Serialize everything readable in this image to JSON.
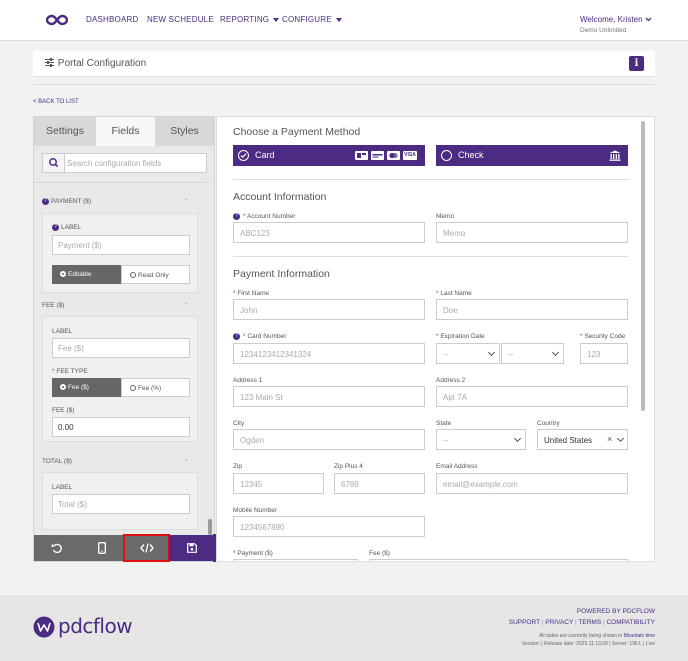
{
  "nav": {
    "items": [
      {
        "label": "DASHBOARD",
        "has_caret": false
      },
      {
        "label": "NEW SCHEDULE",
        "has_caret": false
      },
      {
        "label": "REPORTING",
        "has_caret": true
      },
      {
        "label": "CONFIGURE",
        "has_caret": true
      }
    ],
    "welcome": "Welcome, Kristen",
    "company": "Demo Unlimited",
    "accent_color": "#4b2c82",
    "logo_icon": "infinity-icon"
  },
  "header": {
    "title": "Portal Configuration",
    "title_icon": "sliders-icon",
    "info_label": "i"
  },
  "back_link": "< BACK TO LIST",
  "left_panel": {
    "tabs": [
      "Settings",
      "Fields",
      "Styles"
    ],
    "active_tab": "Fields",
    "search_placeholder": "Search configuration fields",
    "sections": {
      "payment": {
        "title": "PAYMENT ($)",
        "collapse": "-",
        "label_title": "LABEL",
        "label_placeholder": "Payment ($)",
        "mode_options": [
          "Editable",
          "Read Only"
        ],
        "mode_selected": "Editable"
      },
      "fee": {
        "title": "FEE ($)",
        "collapse": "-",
        "label_title": "LABEL",
        "label_placeholder": "Fee ($)",
        "fee_type_title": "FEE TYPE",
        "fee_type_options": [
          "Fee ($)",
          "Fee (%)"
        ],
        "fee_type_selected": "Fee ($)",
        "fee_amount_title": "FEE ($)",
        "fee_amount_value": "0.00"
      },
      "total": {
        "title": "TOTAL ($)",
        "collapse": "-",
        "label_title": "LABEL",
        "label_placeholder": "Total ($)"
      }
    },
    "toolbar": [
      "undo-icon",
      "mobile-icon",
      "code-icon",
      "save-icon"
    ],
    "collapse_icon": "double-chevron-left-icon"
  },
  "form": {
    "payment_method_title": "Choose a Payment Method",
    "methods": [
      {
        "label": "Card",
        "icons": [
          "discover-card-icon",
          "amex-card-icon",
          "mastercard-icon",
          "visa-icon"
        ],
        "visa_text": "VISA"
      },
      {
        "label": "Check",
        "icons": [
          "bank-icon"
        ]
      }
    ],
    "account_info_title": "Account Information",
    "account_number_label": "Account Number",
    "account_number_placeholder": "ABC123",
    "memo_label": "Memo",
    "memo_placeholder": "Memo",
    "payment_info_title": "Payment Information",
    "first_name_label": "First Name",
    "first_name_placeholder": "John",
    "last_name_label": "Last Name",
    "last_name_placeholder": "Doe",
    "card_number_label": "Card Number",
    "card_number_placeholder": "1234123412341324",
    "expiration_label": "Expiration Date",
    "expiration_month_placeholder": "--",
    "expiration_year_placeholder": "--",
    "security_code_label": "Security Code",
    "security_code_placeholder": "123",
    "address1_label": "Address 1",
    "address1_placeholder": "123 Main St",
    "address2_label": "Address 2",
    "address2_placeholder": "Apt 7A",
    "city_label": "City",
    "city_placeholder": "Ogden",
    "state_label": "State",
    "state_placeholder": "--",
    "country_label": "Country",
    "country_value": "United States",
    "country_clear": "×",
    "zip_label": "Zip",
    "zip_placeholder": "12345",
    "zip4_label": "Zip Plus 4",
    "zip4_placeholder": "6789",
    "email_label": "Email Address",
    "email_placeholder": "email@example.com",
    "mobile_label": "Mobile Number",
    "mobile_placeholder": "1234567890",
    "payment_label": "Payment ($)",
    "fee_label": "Fee ($)",
    "required_mark": "*",
    "help_mark": "?"
  },
  "footer": {
    "logo_text": "pdcflow",
    "powered_by": "POWERED BY PDCFLOW",
    "links": [
      "SUPPORT",
      "PRIVACY",
      "TERMS",
      "COMPATIBILITY"
    ],
    "link_separator": "|",
    "timezone_note_prefix": "All dates are currently being shown in",
    "timezone_name": "Mountain time",
    "version_line": "Version: | Release date: 2025.11.13.09 | Server: 196 L | Live"
  }
}
